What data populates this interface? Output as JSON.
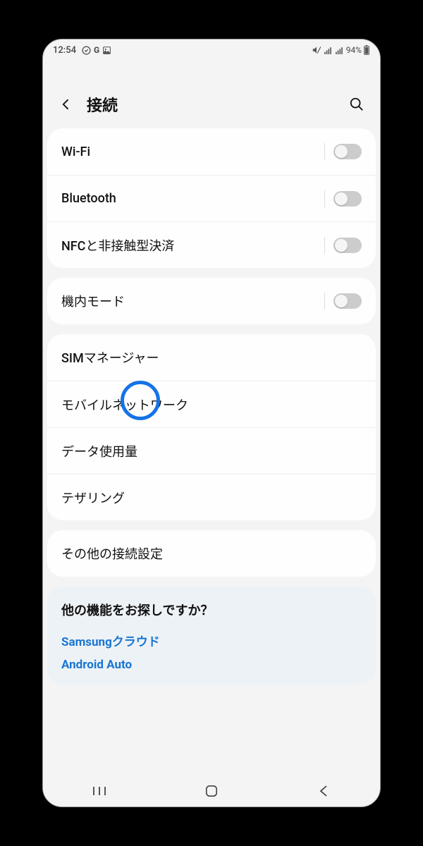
{
  "statusbar": {
    "time": "12:54",
    "battery": "94%"
  },
  "header": {
    "title": "接続"
  },
  "groups": [
    {
      "items": [
        {
          "label": "Wi-Fi",
          "toggle": true,
          "state": "off"
        },
        {
          "label": "Bluetooth",
          "toggle": true,
          "state": "off"
        },
        {
          "label": "NFCと非接触型決済",
          "toggle": true,
          "state": "off"
        }
      ]
    },
    {
      "items": [
        {
          "label": "機内モード",
          "toggle": true,
          "state": "off"
        }
      ]
    },
    {
      "items": [
        {
          "label": "SIMマネージャー",
          "toggle": false,
          "highlight": true
        },
        {
          "label": "モバイルネットワーク",
          "toggle": false
        },
        {
          "label": "データ使用量",
          "toggle": false
        },
        {
          "label": "テザリング",
          "toggle": false
        }
      ]
    },
    {
      "items": [
        {
          "label": "その他の接続設定",
          "toggle": false
        }
      ]
    }
  ],
  "suggest": {
    "title": "他の機能をお探しですか？",
    "links": [
      "Samsungクラウド",
      "Android Auto"
    ]
  }
}
